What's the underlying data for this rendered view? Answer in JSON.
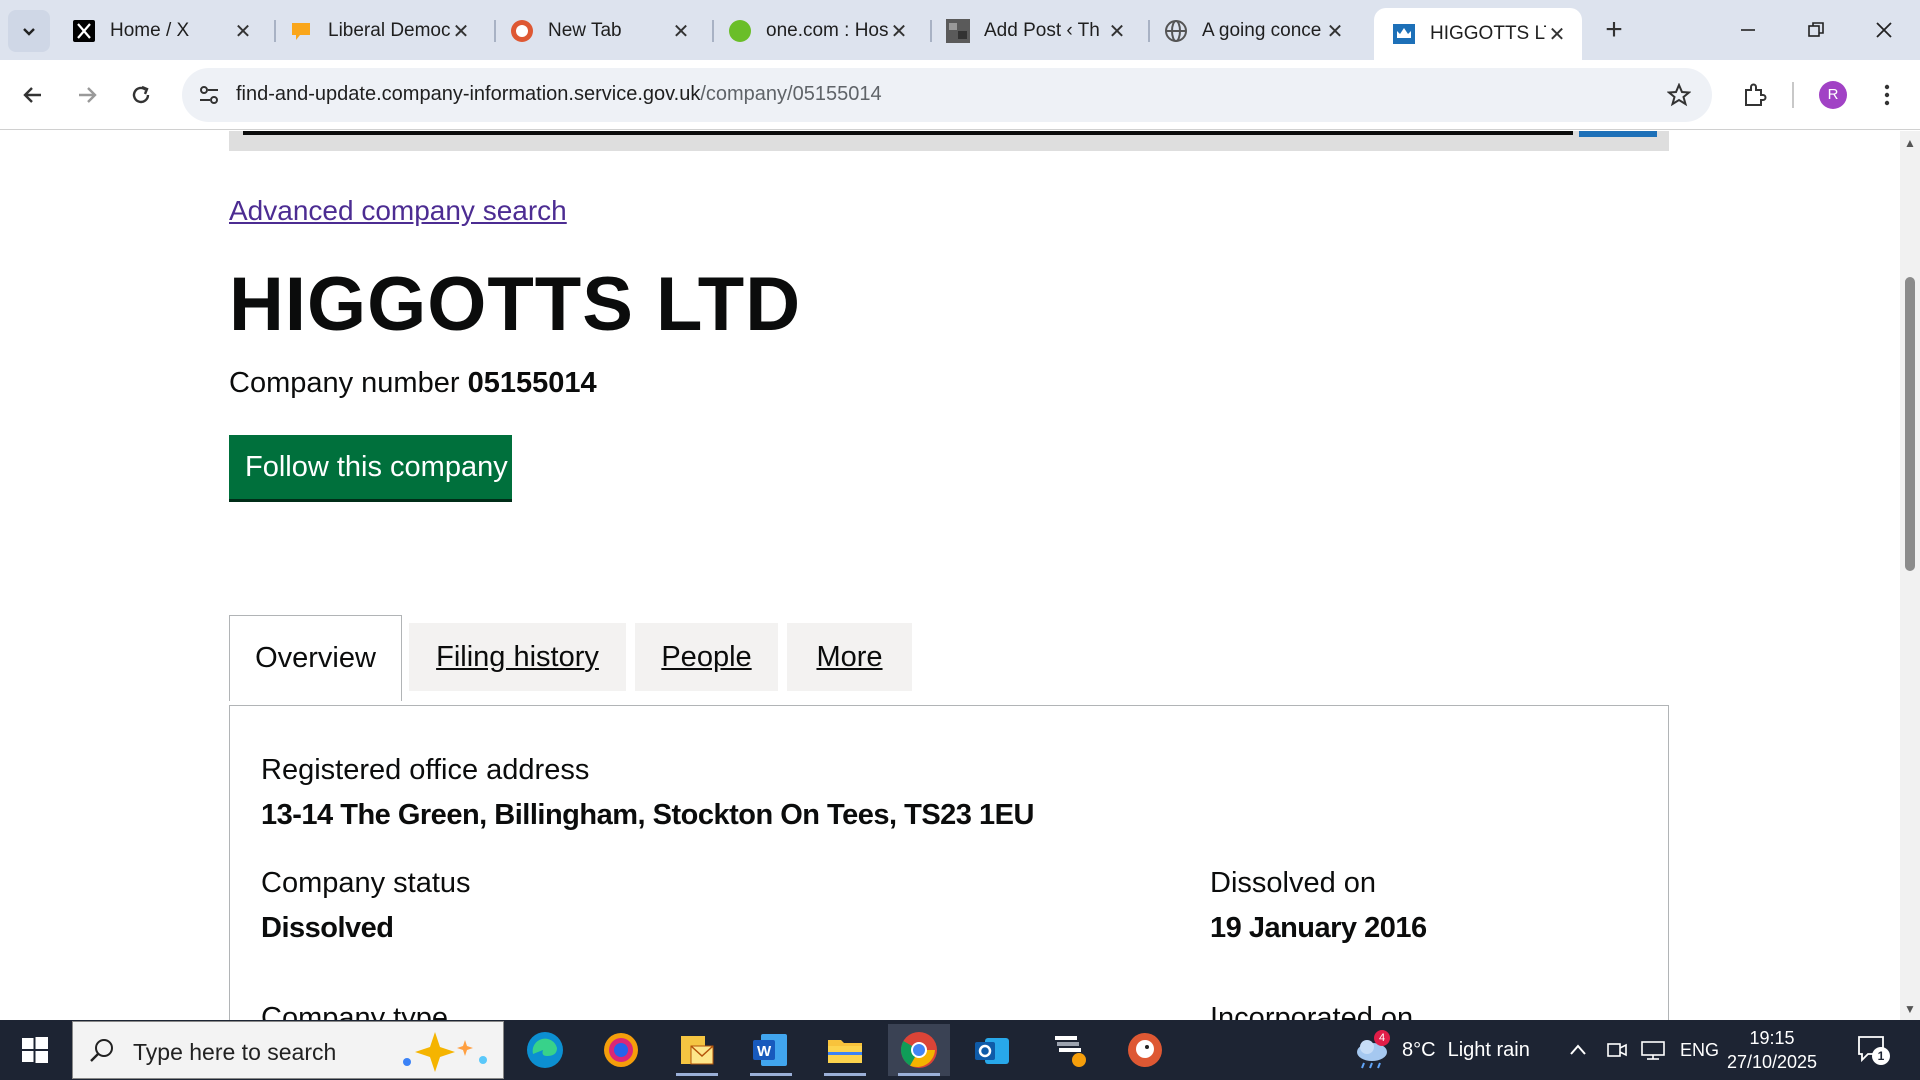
{
  "browser": {
    "tabs": [
      {
        "title": "Home / X",
        "icon": "x-logo-icon"
      },
      {
        "title": "Liberal Democ",
        "icon": "libdem-icon"
      },
      {
        "title": "New Tab",
        "icon": "duckduckgo-icon"
      },
      {
        "title": "one.com : Hos",
        "icon": "onecom-icon"
      },
      {
        "title": "Add Post ‹ Th",
        "icon": "wordpress-thumbnail-icon"
      },
      {
        "title": "A going conce",
        "icon": "globe-icon"
      },
      {
        "title": "HIGGOTTS LTD",
        "icon": "crown-icon",
        "active": true
      }
    ],
    "url_host": "find-and-update.company-information.service.gov.uk",
    "url_path": "/company/05155014",
    "profile_initial": "R"
  },
  "page": {
    "advanced_search_link": "Advanced company search",
    "company_name": "HIGGOTTS LTD",
    "company_number_label": "Company number",
    "company_number": "05155014",
    "follow_button": "Follow this company",
    "tabs": [
      "Overview",
      "Filing history",
      "People",
      "More"
    ],
    "registered_office_label": "Registered office address",
    "registered_office_value": "13-14 The Green, Billingham, Stockton On Tees, TS23 1EU",
    "status_label": "Company status",
    "status_value": "Dissolved",
    "dissolved_label": "Dissolved on",
    "dissolved_value": "19 January 2016",
    "company_type_label": "Company type",
    "incorporated_label": "Incorporated on"
  },
  "taskbar": {
    "search_placeholder": "Type here to search",
    "weather_temp": "8°C",
    "weather_text": "Light rain",
    "weather_badge": "4",
    "language": "ENG",
    "time": "19:15",
    "date": "27/10/2025",
    "notification_count": "1"
  },
  "colors": {
    "link": "#4c2c92",
    "follow_button": "#00703c",
    "gov_text": "#0b0c0c"
  }
}
